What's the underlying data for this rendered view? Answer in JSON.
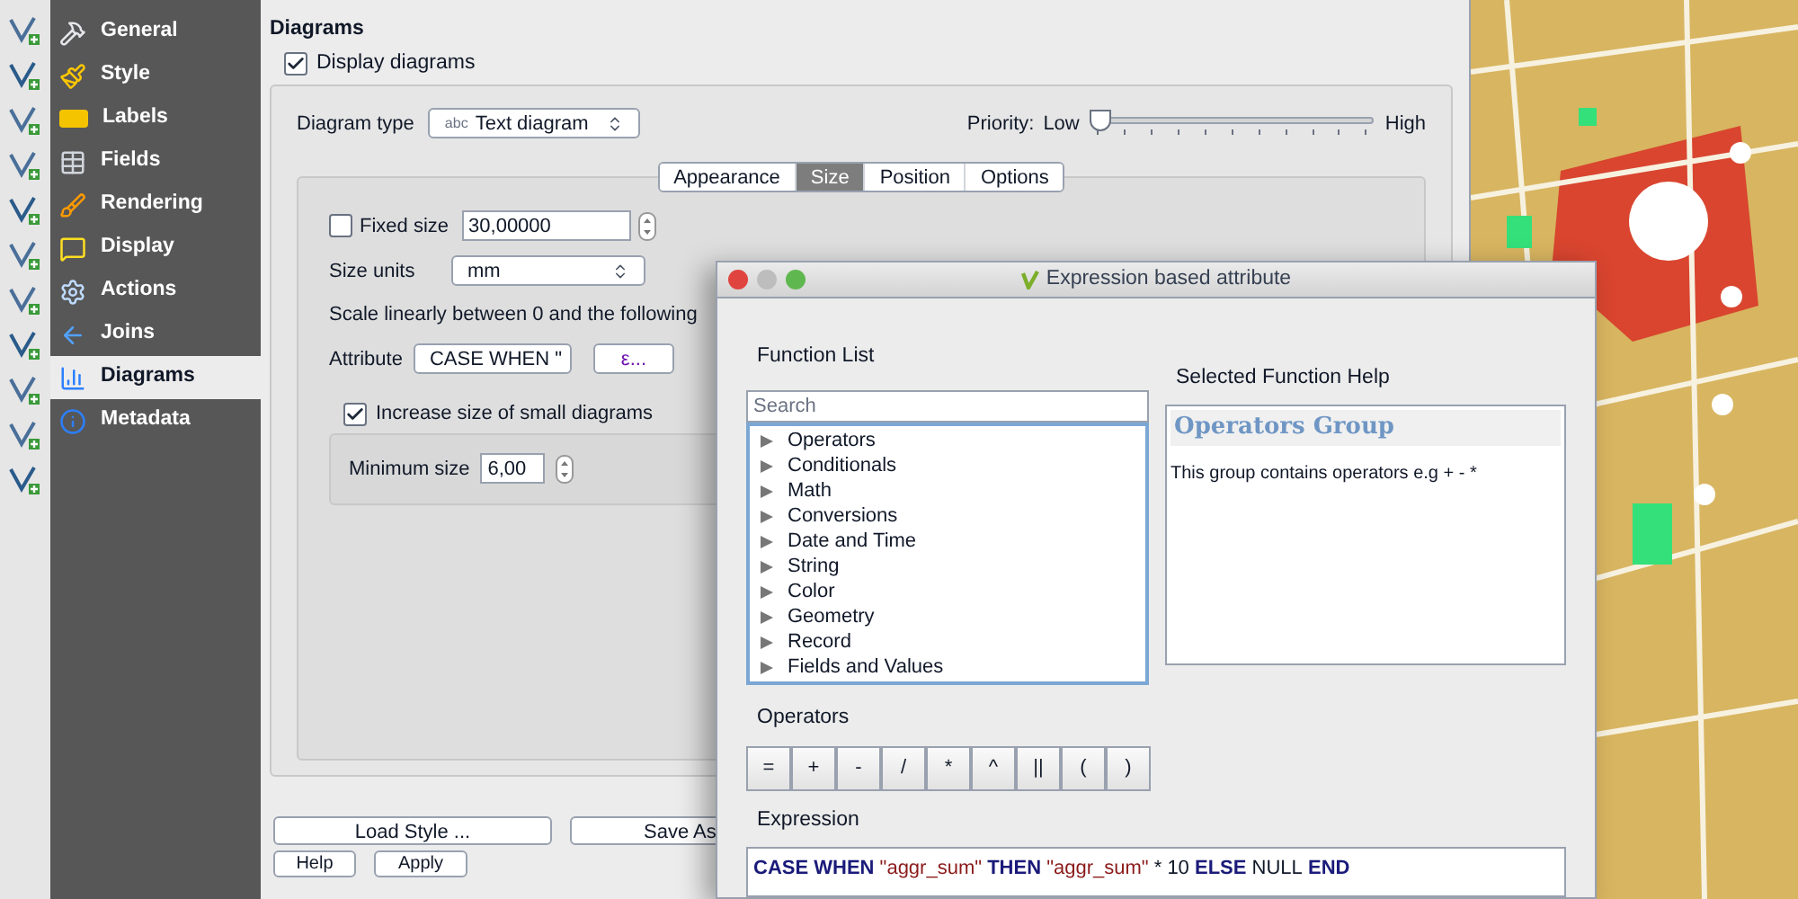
{
  "sidebar": {
    "items": [
      {
        "label": "General",
        "selected": false
      },
      {
        "label": "Style",
        "selected": false
      },
      {
        "label": "Labels",
        "selected": false
      },
      {
        "label": "Fields",
        "selected": false
      },
      {
        "label": "Rendering",
        "selected": false
      },
      {
        "label": "Display",
        "selected": false
      },
      {
        "label": "Actions",
        "selected": false
      },
      {
        "label": "Joins",
        "selected": false
      },
      {
        "label": "Diagrams",
        "selected": true
      },
      {
        "label": "Metadata",
        "selected": false
      }
    ]
  },
  "page": {
    "title": "Diagrams",
    "display_diagrams": {
      "label": "Display diagrams",
      "checked": true
    },
    "diagram_type": {
      "label": "Diagram type",
      "icon_text": "abc",
      "value": "Text diagram"
    },
    "priority": {
      "label": "Priority:",
      "low": "Low",
      "high": "High",
      "level": 0
    },
    "tabs": [
      {
        "label": "Appearance",
        "selected": false
      },
      {
        "label": "Size",
        "selected": true
      },
      {
        "label": "Position",
        "selected": false
      },
      {
        "label": "Options",
        "selected": false
      }
    ],
    "fixed_size": {
      "label": "Fixed size",
      "checked": false,
      "value": "30,00000"
    },
    "size_units": {
      "label": "Size units",
      "value": "mm"
    },
    "scale_text": "Scale linearly between 0 and the following",
    "attribute": {
      "label": "Attribute",
      "value": "CASE WHEN \"",
      "button": "ε..."
    },
    "increase_small": {
      "label": "Increase size of small diagrams",
      "checked": true
    },
    "minimum_size": {
      "label": "Minimum size",
      "value": "6,00"
    }
  },
  "buttons": [
    "Load Style ...",
    "Save As",
    "Help",
    "Apply"
  ],
  "expression_dialog": {
    "title": "Expression based attribute",
    "function_list_label": "Function List",
    "search": {
      "placeholder": "Search"
    },
    "functions": [
      {
        "label": "Operators",
        "expanded": false
      },
      {
        "label": "Conditionals",
        "expanded": false
      },
      {
        "label": "Math",
        "expanded": false
      },
      {
        "label": "Conversions",
        "expanded": false
      },
      {
        "label": "Date and Time",
        "expanded": false
      },
      {
        "label": "String",
        "expanded": false
      },
      {
        "label": "Color",
        "expanded": false
      },
      {
        "label": "Geometry",
        "expanded": false
      },
      {
        "label": "Record",
        "expanded": false
      },
      {
        "label": "Fields and Values",
        "expanded": false
      }
    ],
    "help_label": "Selected Function Help",
    "help": {
      "title": "Operators Group",
      "text": "This group contains operators e.g + - *"
    },
    "operators_label": "Operators",
    "operators": [
      "=",
      "+",
      "-",
      "/",
      "*",
      "^",
      "||",
      "(",
      ")"
    ],
    "expression_label": "Expression",
    "expression": [
      {
        "kind": "keyword",
        "text": "CASE WHEN"
      },
      {
        "kind": "string",
        "text": "\"aggr_sum\""
      },
      {
        "kind": "keyword",
        "text": "THEN"
      },
      {
        "kind": "string",
        "text": "\"aggr_sum\""
      },
      {
        "kind": "plain",
        "text": "* 10"
      },
      {
        "kind": "keyword",
        "text": "ELSE"
      },
      {
        "kind": "plain",
        "text": "NULL"
      },
      {
        "kind": "keyword",
        "text": "END"
      }
    ]
  }
}
